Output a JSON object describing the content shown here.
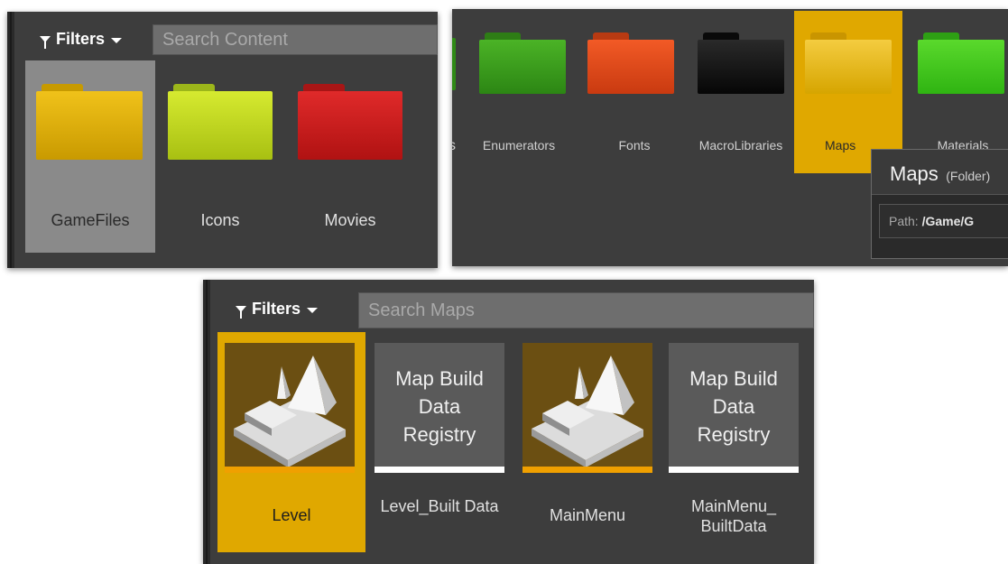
{
  "panel1": {
    "filters_label": "Filters",
    "search_placeholder": "Search Content",
    "folders": [
      {
        "label": "GameFiles",
        "color": "#d9a900",
        "selected": true
      },
      {
        "label": "Icons",
        "color": "#b7d01a",
        "selected": false
      },
      {
        "label": "Movies",
        "color": "#c41a1a",
        "selected": false
      }
    ]
  },
  "panel2": {
    "partial_label": "s",
    "folders": [
      {
        "label": "Enumerators",
        "color": "#3d9e1c"
      },
      {
        "label": "Fonts",
        "color": "#e04a1a"
      },
      {
        "label": "MacroLibraries",
        "color": "#111111"
      },
      {
        "label": "Maps",
        "color": "#e0a800",
        "selected": true
      },
      {
        "label": "Materials",
        "color": "#3fc21a"
      }
    ],
    "tooltip": {
      "title": "Maps",
      "type": "(Folder)",
      "path_label": "Path:",
      "path_value": "/Game/G"
    }
  },
  "panel3": {
    "filters_label": "Filters",
    "search_placeholder": "Search Maps",
    "assets": [
      {
        "label": "Level",
        "kind": "level",
        "selected": true
      },
      {
        "label": "Level_Built Data",
        "kind": "mbdr",
        "text": "Map Build Data Registry"
      },
      {
        "label": "MainMenu",
        "kind": "level",
        "selected": false
      },
      {
        "label": "MainMenu_ BuiltData",
        "kind": "mbdr",
        "text": "Map Build Data Registry"
      }
    ]
  },
  "colors": {
    "panel_bg": "#3d3d3d",
    "selection_gold": "#e0a800",
    "level_bar": "#f0a000",
    "search_bg": "#6e6e6e"
  }
}
